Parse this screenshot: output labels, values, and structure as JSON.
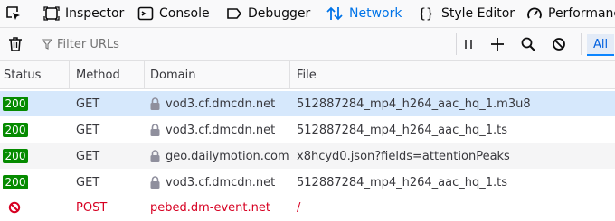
{
  "tabs": [
    {
      "label": "",
      "icon": "element-picker-icon"
    },
    {
      "label": "Inspector",
      "icon": "inspector-icon"
    },
    {
      "label": "Console",
      "icon": "console-icon"
    },
    {
      "label": "Debugger",
      "icon": "debugger-icon"
    },
    {
      "label": "Network",
      "icon": "network-icon",
      "active": true
    },
    {
      "label": "Style Editor",
      "icon": "style-editor-icon"
    },
    {
      "label": "Performance",
      "icon": "performance-icon"
    }
  ],
  "toolbar": {
    "filter_placeholder": "Filter URLs",
    "all_label": "All"
  },
  "columns": [
    "Status",
    "Method",
    "Domain",
    "File"
  ],
  "requests": [
    {
      "status": "200",
      "method": "GET",
      "domain": "vod3.cf.dmcdn.net",
      "file": "512887284_mp4_h264_aac_hq_1.m3u8",
      "secure": true
    },
    {
      "status": "200",
      "method": "GET",
      "domain": "vod3.cf.dmcdn.net",
      "file": "512887284_mp4_h264_aac_hq_1.ts",
      "secure": true
    },
    {
      "status": "200",
      "method": "GET",
      "domain": "geo.dailymotion.com",
      "file": "x8hcyd0.json?fields=attentionPeaks",
      "secure": true
    },
    {
      "status": "200",
      "method": "GET",
      "domain": "vod3.cf.dmcdn.net",
      "file": "512887284_mp4_h264_aac_hq_1.ts",
      "secure": true
    },
    {
      "status": "",
      "method": "POST",
      "domain": "pebed.dm-event.net",
      "file": "/",
      "secure": false,
      "blocked": true
    }
  ],
  "colors": {
    "accent": "#0074e8",
    "status_ok": "#058b00",
    "error": "#d70022",
    "selected": "#d6e8fc"
  }
}
